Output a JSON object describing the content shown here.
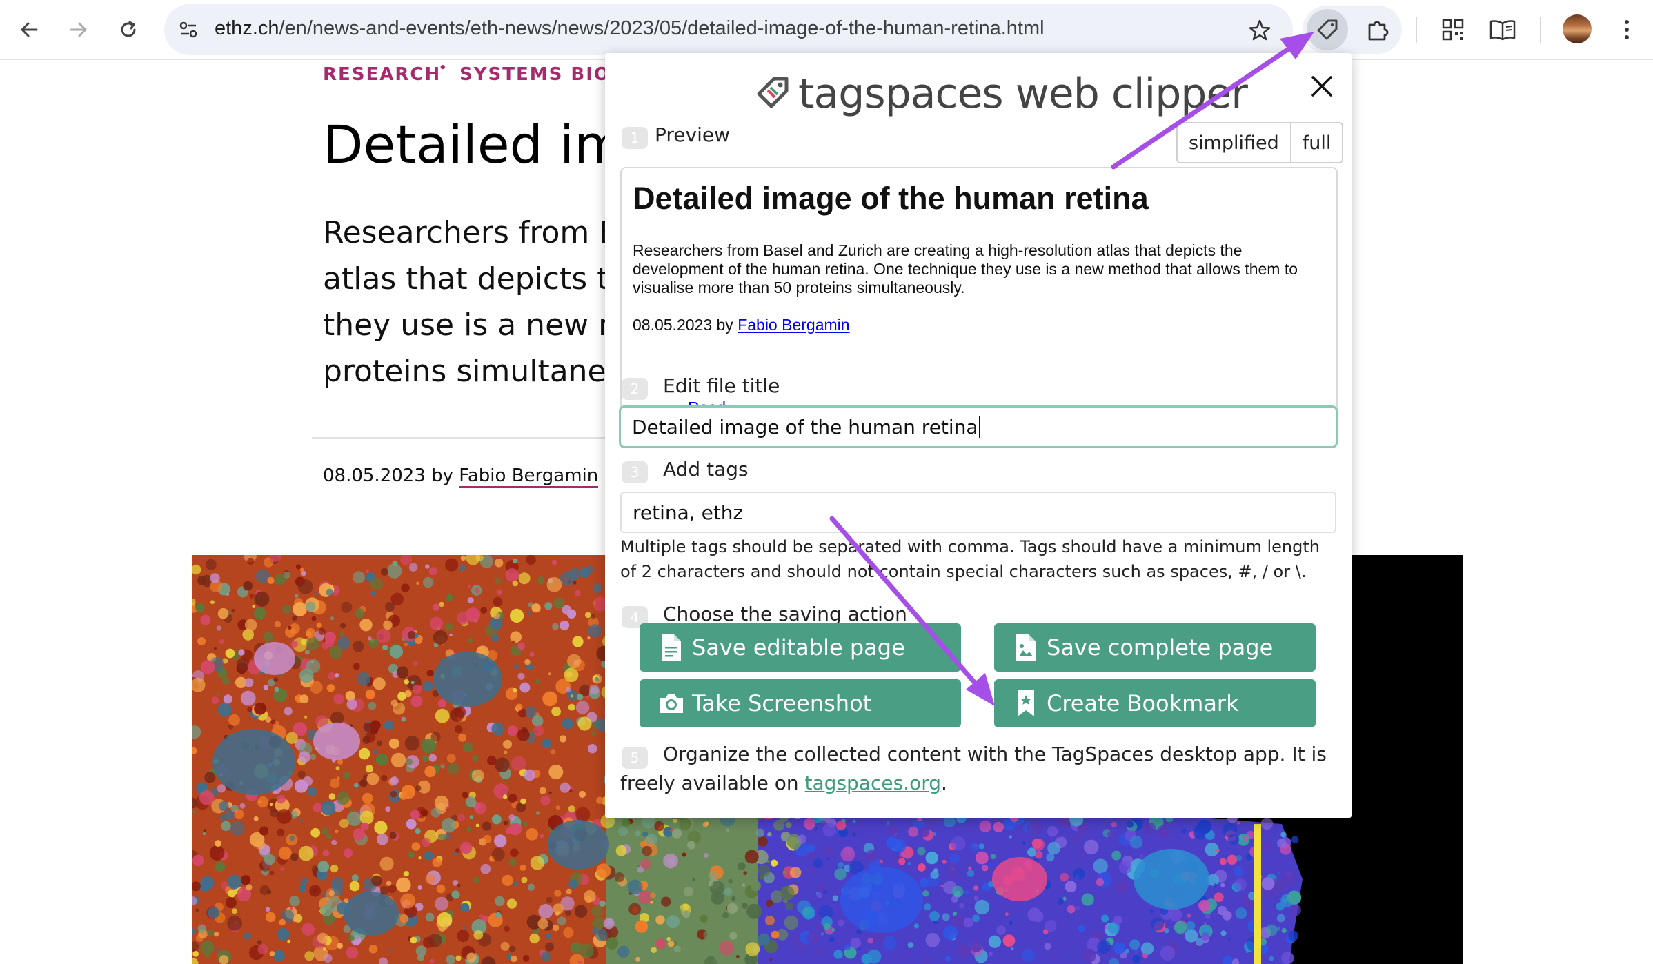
{
  "browser": {
    "url_host": "ethz.ch",
    "url_path": "/en/news-and-events/eth-news/news/2023/05/detailed-image-of-the-human-retina.html"
  },
  "article": {
    "kicker_1": "RESEARCH",
    "kicker_sep": "•",
    "kicker_2": "SYSTEMS BIOLO",
    "title": "Detailed ima",
    "lead_lines": [
      "Researchers from B",
      "atlas that depicts th",
      "they use is a new m",
      "proteins simultaneo"
    ],
    "date_prefix": "08.05.2023 by ",
    "author": "Fabio Bergamin"
  },
  "clipper": {
    "logo_text": "tagspaces web clipper",
    "steps": [
      {
        "num": "1",
        "label": "Preview"
      },
      {
        "num": "2",
        "label": "Edit file title"
      },
      {
        "num": "3",
        "label": "Add tags"
      },
      {
        "num": "4",
        "label": "Choose the saving action"
      },
      {
        "num": "5"
      }
    ],
    "mode_simplified": "simplified",
    "mode_full": "full",
    "preview": {
      "title": "Detailed image of the human retina",
      "body": "Researchers from Basel and Zurich are creating a high-resolution atlas that depicts the development of the human retina. One technique they use is a new method that allows them to visualise more than 50 proteins simultaneously.",
      "date_prefix": "08.05.2023 by ",
      "author": "Fabio Bergamin",
      "read": "Read"
    },
    "file_title_value": "Detailed image of the human retina",
    "tags_value": "retina, ethz",
    "tags_help": "Multiple tags should be separated with comma. Tags should have a minimum length of 2 characters and should not contain special characters such as spaces, #, / or \\.",
    "actions": {
      "save_editable": "Save editable page",
      "save_complete": "Save complete page",
      "screenshot": "Take Screenshot",
      "bookmark": "Create Bookmark"
    },
    "organize_text": "Organize the collected content with the TagSpaces desktop app. It is freely available on ",
    "organize_link": "tagspaces.org",
    "organize_end": "."
  },
  "colors": {
    "accent_green": "#4a9e84",
    "kicker": "#a62b6e",
    "arrow": "#a64ee8"
  }
}
